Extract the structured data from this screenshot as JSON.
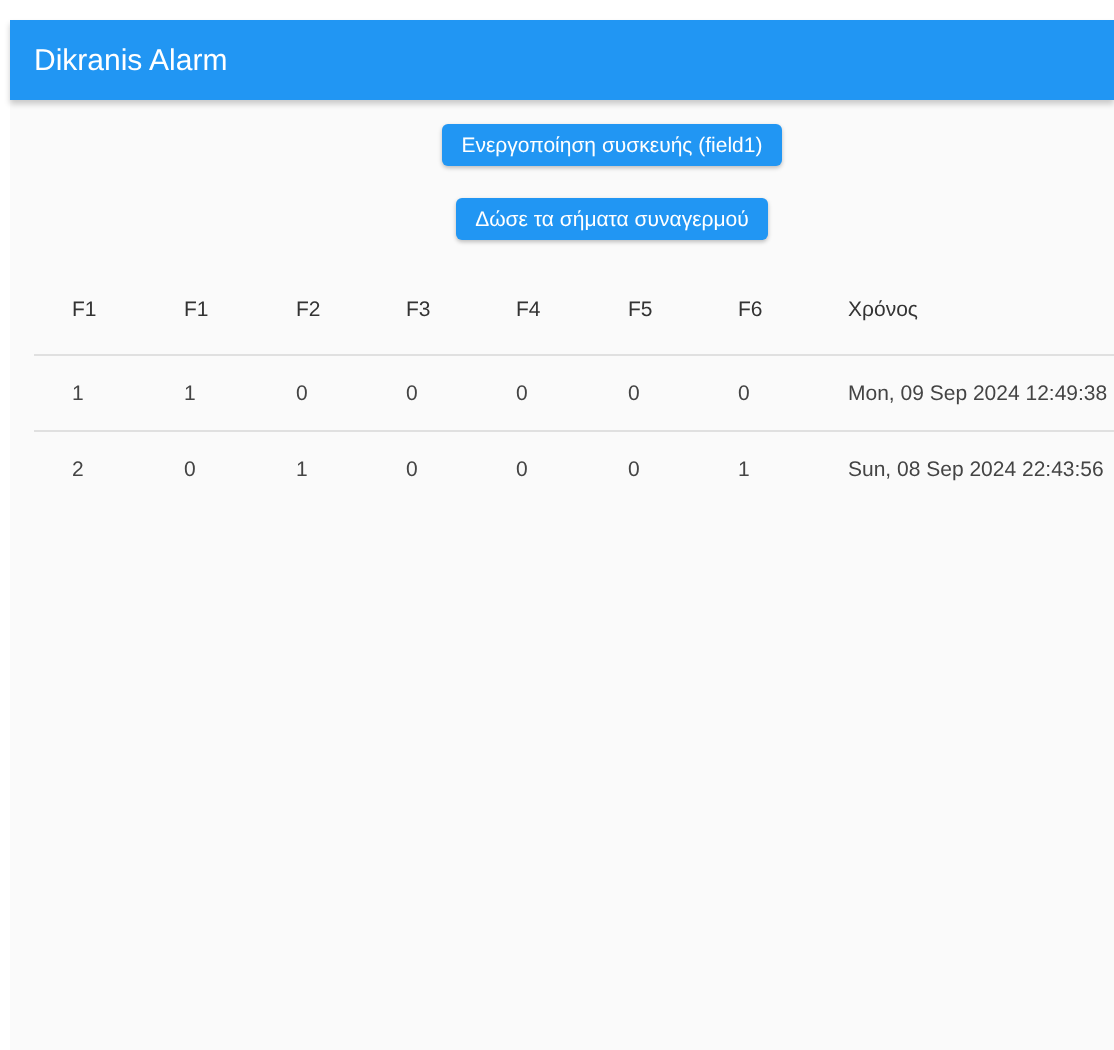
{
  "app_bar": {
    "title": "Dikranis Alarm"
  },
  "buttons": [
    "Ενεργοποίηση συσκευής (field1)",
    "Δώσε τα σήματα συναγερμού"
  ],
  "table": {
    "columns": [
      "F1",
      "F1",
      "F2",
      "F3",
      "F4",
      "F5",
      "F6",
      "Χρόνος"
    ],
    "rows": [
      [
        "1",
        "1",
        "0",
        "0",
        "0",
        "0",
        "0",
        "Mon, 09 Sep 2024 12:49:38"
      ],
      [
        "2",
        "0",
        "1",
        "0",
        "0",
        "0",
        "1",
        "Sun, 08 Sep 2024 22:43:56"
      ]
    ]
  }
}
